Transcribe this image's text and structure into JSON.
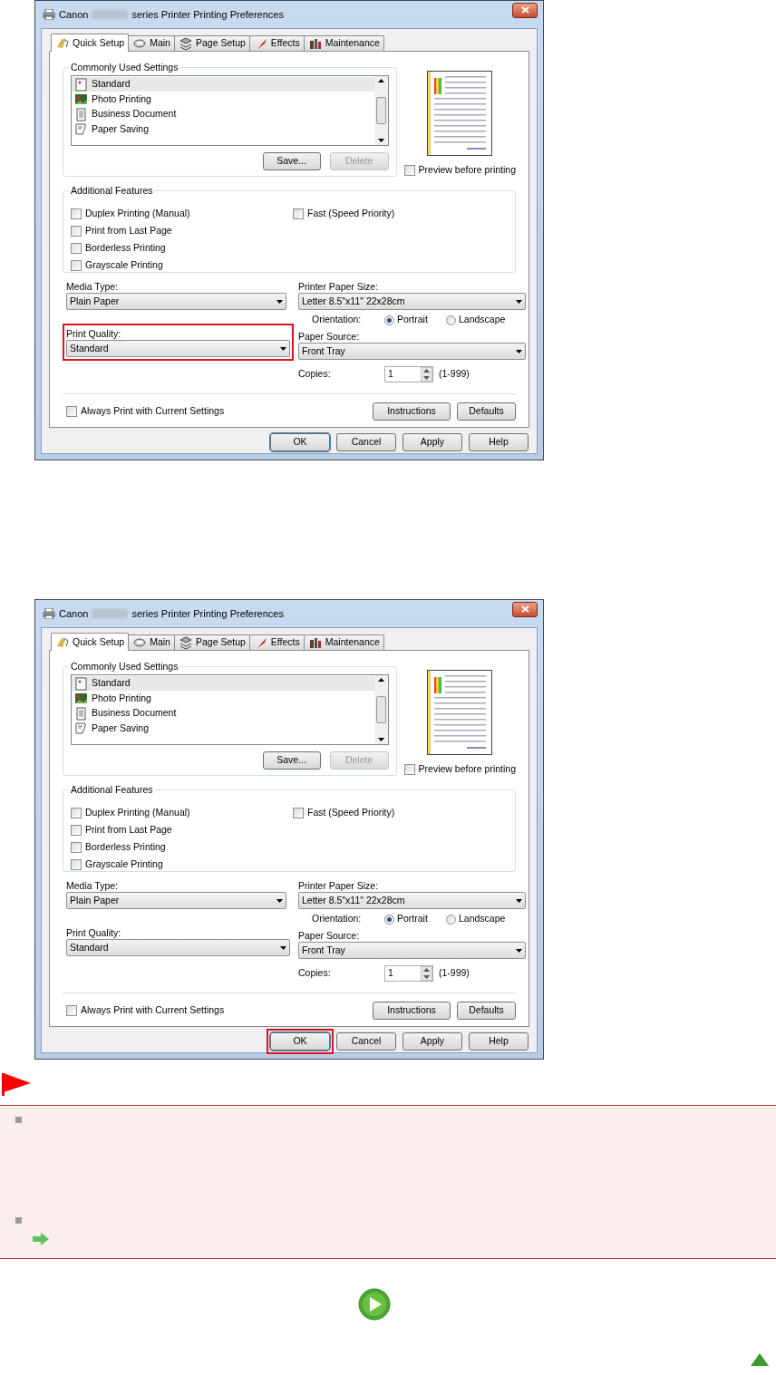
{
  "dialogs": [
    {
      "title_start": "Canon",
      "title_end": "series Printer Printing Preferences",
      "tabs": [
        {
          "label": "Quick Setup",
          "selected": true
        },
        {
          "label": "Main",
          "selected": false
        },
        {
          "label": "Page Setup",
          "selected": false
        },
        {
          "label": "Effects",
          "selected": false
        },
        {
          "label": "Maintenance",
          "selected": false
        }
      ],
      "commonly_used": {
        "label": "Commonly Used Settings",
        "items": [
          {
            "label": "Standard",
            "selected": true
          },
          {
            "label": "Photo Printing",
            "selected": false
          },
          {
            "label": "Business Document",
            "selected": false
          },
          {
            "label": "Paper Saving",
            "selected": false
          }
        ],
        "save": {
          "label": "Save...",
          "disabled": false
        },
        "delete": {
          "label": "Delete",
          "disabled": true
        }
      },
      "preview": {
        "label": "Preview before printing",
        "checked": false
      },
      "additional": {
        "label": "Additional Features",
        "left": [
          {
            "label": "Duplex Printing (Manual)",
            "checked": false
          },
          {
            "label": "Print from Last Page",
            "checked": false
          },
          {
            "label": "Borderless Printing",
            "checked": false
          },
          {
            "label": "Grayscale Printing",
            "checked": false
          }
        ],
        "right": [
          {
            "label": "Fast (Speed Priority)",
            "checked": false
          }
        ]
      },
      "media_type": {
        "label": "Media Type:",
        "value": "Plain Paper"
      },
      "paper_size": {
        "label": "Printer Paper Size:",
        "value": "Letter 8.5\"x11\" 22x28cm"
      },
      "orientation": {
        "label": "Orientation:",
        "options": [
          {
            "label": "Portrait",
            "selected": true
          },
          {
            "label": "Landscape",
            "selected": false
          }
        ]
      },
      "print_quality": {
        "label": "Print Quality:",
        "value": "Standard",
        "highlighted": true
      },
      "paper_source": {
        "label": "Paper Source:",
        "value": "Front Tray"
      },
      "copies": {
        "label": "Copies:",
        "value": "1",
        "range": "(1-999)"
      },
      "always_print": {
        "label": "Always Print with Current Settings",
        "checked": false
      },
      "panel_buttons": [
        "Instructions",
        "Defaults"
      ],
      "buttons": [
        {
          "label": "OK",
          "default": true,
          "highlighted": false
        },
        {
          "label": "Cancel",
          "default": false,
          "highlighted": false
        },
        {
          "label": "Apply",
          "default": false,
          "highlighted": false
        },
        {
          "label": "Help",
          "default": false,
          "highlighted": false
        }
      ]
    },
    {
      "title_start": "Canon",
      "title_end": "series Printer Printing Preferences",
      "tabs": [
        {
          "label": "Quick Setup",
          "selected": true
        },
        {
          "label": "Main",
          "selected": false
        },
        {
          "label": "Page Setup",
          "selected": false
        },
        {
          "label": "Effects",
          "selected": false
        },
        {
          "label": "Maintenance",
          "selected": false
        }
      ],
      "commonly_used": {
        "label": "Commonly Used Settings",
        "items": [
          {
            "label": "Standard",
            "selected": true
          },
          {
            "label": "Photo Printing",
            "selected": false
          },
          {
            "label": "Business Document",
            "selected": false
          },
          {
            "label": "Paper Saving",
            "selected": false
          }
        ],
        "save": {
          "label": "Save...",
          "disabled": false
        },
        "delete": {
          "label": "Delete",
          "disabled": true
        }
      },
      "preview": {
        "label": "Preview before printing",
        "checked": false
      },
      "additional": {
        "label": "Additional Features",
        "left": [
          {
            "label": "Duplex Printing (Manual)",
            "checked": false
          },
          {
            "label": "Print from Last Page",
            "checked": false
          },
          {
            "label": "Borderless Printing",
            "checked": false
          },
          {
            "label": "Grayscale Printing",
            "checked": false
          }
        ],
        "right": [
          {
            "label": "Fast (Speed Priority)",
            "checked": false
          }
        ]
      },
      "media_type": {
        "label": "Media Type:",
        "value": "Plain Paper"
      },
      "paper_size": {
        "label": "Printer Paper Size:",
        "value": "Letter 8.5\"x11\" 22x28cm"
      },
      "orientation": {
        "label": "Orientation:",
        "options": [
          {
            "label": "Portrait",
            "selected": true
          },
          {
            "label": "Landscape",
            "selected": false
          }
        ]
      },
      "print_quality": {
        "label": "Print Quality:",
        "value": "Standard",
        "highlighted": false
      },
      "paper_source": {
        "label": "Paper Source:",
        "value": "Front Tray"
      },
      "copies": {
        "label": "Copies:",
        "value": "1",
        "range": "(1-999)"
      },
      "always_print": {
        "label": "Always Print with Current Settings",
        "checked": false
      },
      "panel_buttons": [
        "Instructions",
        "Defaults"
      ],
      "buttons": [
        {
          "label": "OK",
          "default": true,
          "highlighted": true
        },
        {
          "label": "Cancel",
          "default": false,
          "highlighted": false
        },
        {
          "label": "Apply",
          "default": false,
          "highlighted": false
        },
        {
          "label": "Help",
          "default": false,
          "highlighted": false
        }
      ]
    }
  ]
}
